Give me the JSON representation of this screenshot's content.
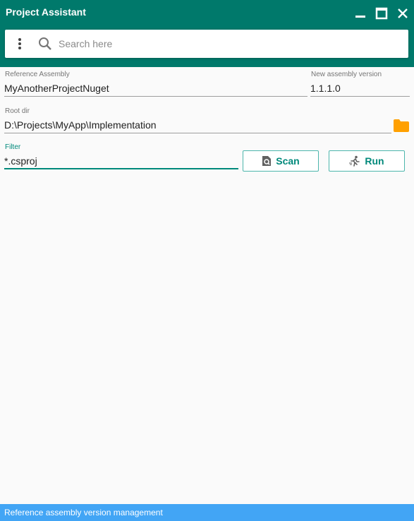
{
  "window": {
    "title": "Project Assistant"
  },
  "search": {
    "placeholder": "Search here",
    "value": ""
  },
  "form": {
    "reference_assembly": {
      "label": "Reference Assembly",
      "value": "MyAnotherProjectNuget"
    },
    "new_version": {
      "label": "New assembly version",
      "value": "1.1.1.0"
    },
    "root_dir": {
      "label": "Root dir",
      "value": "D:\\Projects\\MyApp\\Implementation"
    },
    "filter": {
      "label": "Filter",
      "value": "*.csproj"
    }
  },
  "actions": {
    "scan_label": "Scan",
    "run_label": "Run"
  },
  "status": {
    "text": "Reference assembly version management"
  },
  "colors": {
    "header": "#00796b",
    "accent": "#00897b",
    "status_bar": "#42a5f5",
    "folder": "#ffa000"
  },
  "icons": {
    "menu": "more-vert-icon",
    "search": "search-icon",
    "minimize": "minimize-icon",
    "maximize": "maximize-icon",
    "close": "close-icon",
    "folder": "folder-icon",
    "scan": "file-search-icon",
    "run": "run-icon"
  }
}
